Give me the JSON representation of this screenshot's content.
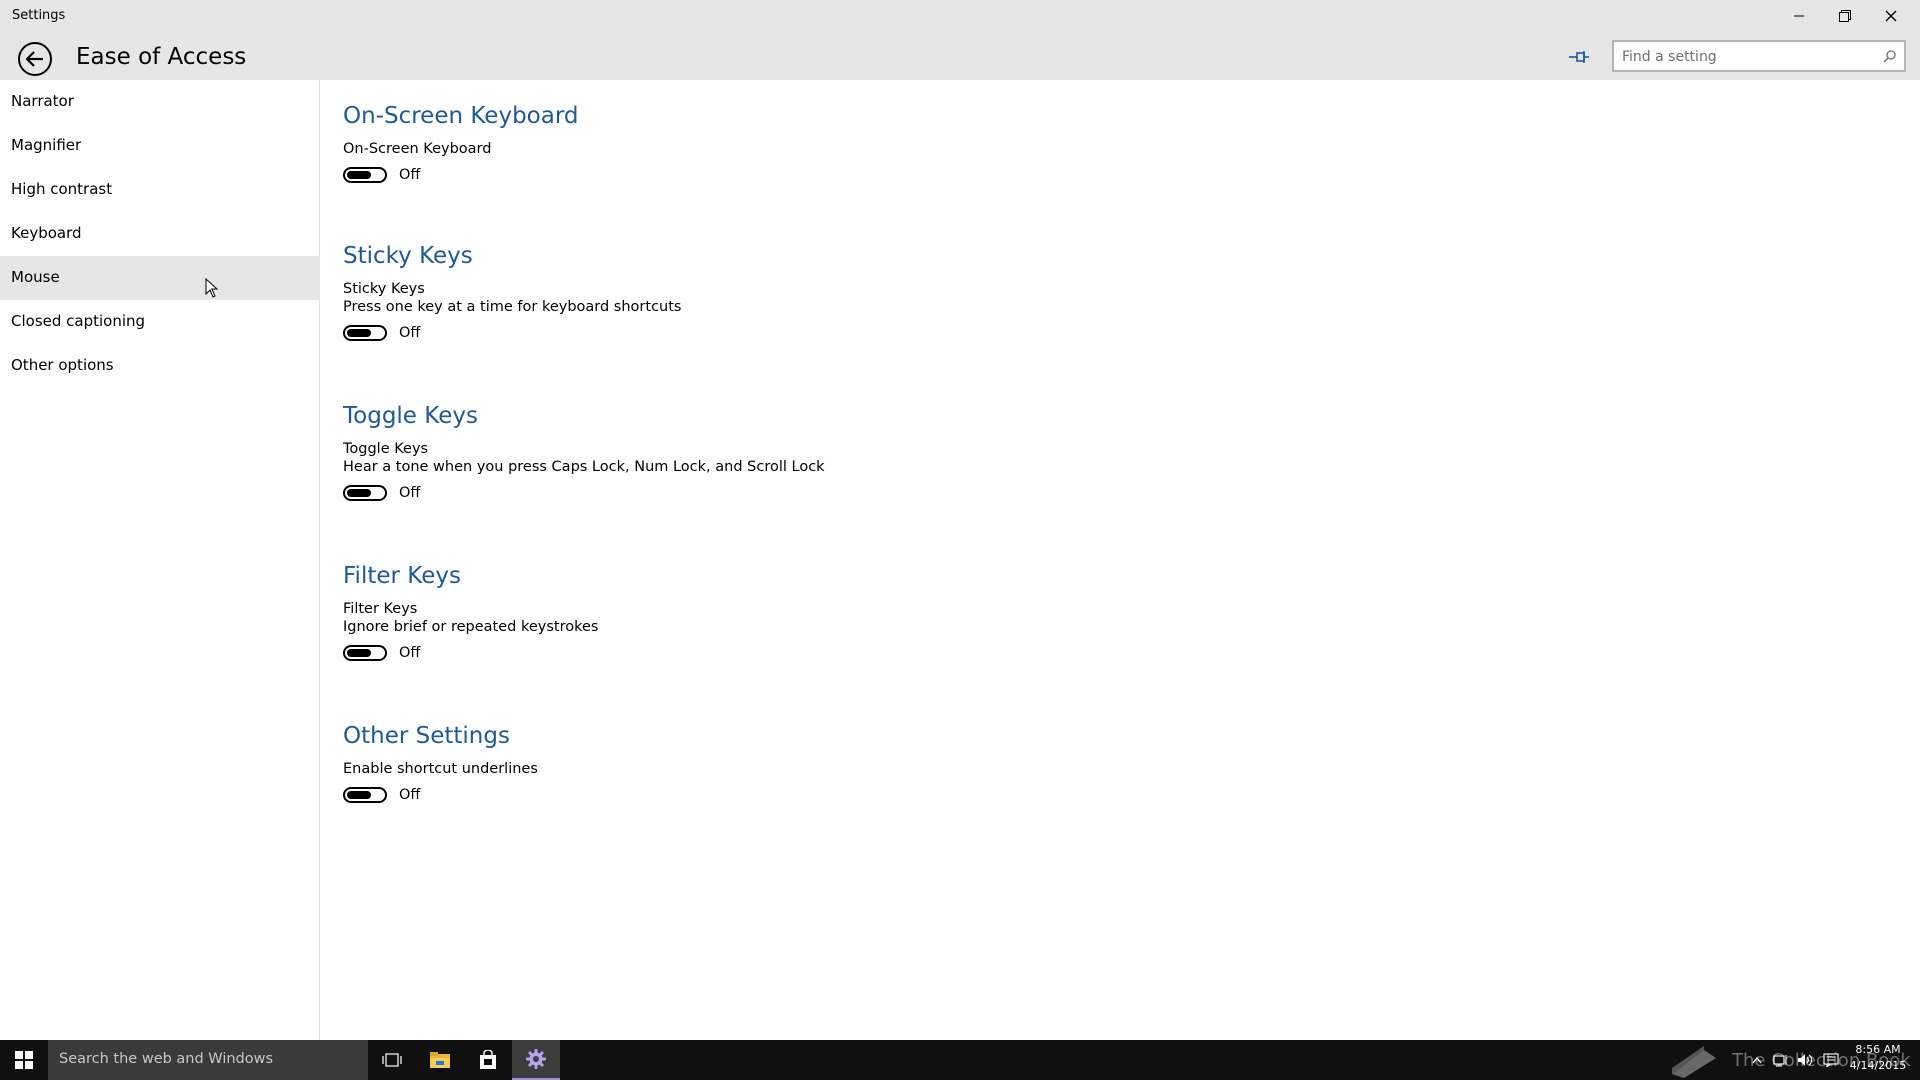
{
  "window": {
    "title": "Settings"
  },
  "header": {
    "title": "Ease of Access",
    "search_placeholder": "Find a setting"
  },
  "sidebar": {
    "items": [
      {
        "label": "Narrator"
      },
      {
        "label": "Magnifier"
      },
      {
        "label": "High contrast"
      },
      {
        "label": "Keyboard"
      },
      {
        "label": "Mouse"
      },
      {
        "label": "Closed captioning"
      },
      {
        "label": "Other options"
      }
    ],
    "hovered": "Mouse"
  },
  "sections": [
    {
      "title": "On-Screen Keyboard",
      "setting": "On-Screen Keyboard",
      "description": "",
      "state": "Off"
    },
    {
      "title": "Sticky Keys",
      "setting": "Sticky Keys",
      "description": "Press one key at a time for keyboard shortcuts",
      "state": "Off"
    },
    {
      "title": "Toggle Keys",
      "setting": "Toggle Keys",
      "description": "Hear a tone when you press Caps Lock, Num Lock, and Scroll Lock",
      "state": "Off"
    },
    {
      "title": "Filter Keys",
      "setting": "Filter Keys",
      "description": "Ignore brief or repeated keystrokes",
      "state": "Off"
    },
    {
      "title": "Other Settings",
      "setting": "Enable shortcut underlines",
      "description": "",
      "state": "Off"
    }
  ],
  "taskbar": {
    "search_text": "Search the web and Windows",
    "icons": [
      "start-icon",
      "task-view-icon",
      "file-explorer-icon",
      "store-icon",
      "settings-icon"
    ],
    "active_app": "settings-icon",
    "time": "8:56 AM",
    "date": "4/14/2015",
    "watermark": "The Collection Book"
  },
  "colors": {
    "section_title": "#1f5a96",
    "chrome_bg": "#e6e6e6",
    "taskbar_bg": "#101010",
    "active_accent": "#a58cd8"
  }
}
